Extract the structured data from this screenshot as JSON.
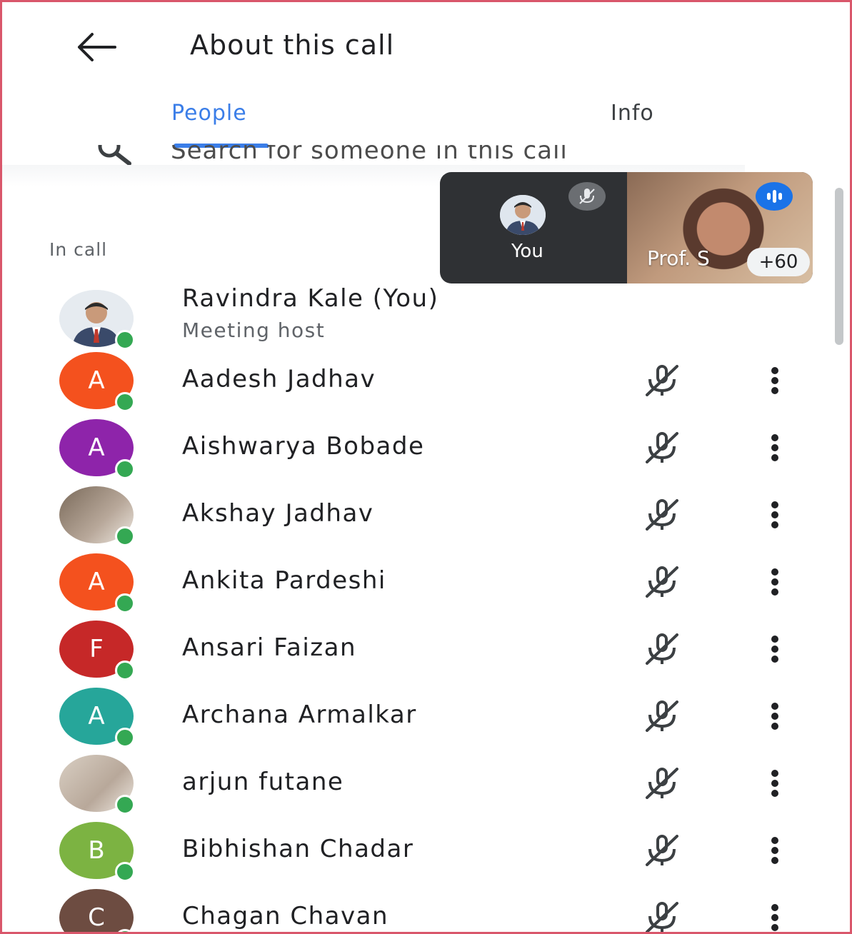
{
  "header": {
    "title": "About this call",
    "back_icon": "arrow-left-icon"
  },
  "tabs": [
    {
      "label": "People",
      "selected": true
    },
    {
      "label": "Info",
      "selected": false
    }
  ],
  "search": {
    "placeholder": "Search for someone in this call",
    "icon": "search-icon"
  },
  "self_view": {
    "label": "You",
    "remote_label": "Prof. S",
    "others_count": "+60"
  },
  "section": {
    "label": "In call"
  },
  "host": {
    "name": "Ravindra Kale (You)",
    "role": "Meeting host"
  },
  "participants": [
    {
      "name": "Aadesh Jadhav",
      "initial": "A",
      "color": "#f4511e"
    },
    {
      "name": "Aishwarya Bobade",
      "initial": "A",
      "color": "#8e24aa"
    },
    {
      "name": "Akshay Jadhav",
      "initial": "",
      "color": "#7a6a5a"
    },
    {
      "name": "Ankita Pardeshi",
      "initial": "A",
      "color": "#f4511e"
    },
    {
      "name": "Ansari Faizan",
      "initial": "F",
      "color": "#c62828"
    },
    {
      "name": "Archana Armalkar",
      "initial": "A",
      "color": "#26a69a"
    },
    {
      "name": "arjun futane",
      "initial": "",
      "color": "#d9cfc3"
    },
    {
      "name": "Bibhishan Chadar",
      "initial": "B",
      "color": "#7cb342"
    },
    {
      "name": "Chagan Chavan",
      "initial": "C",
      "color": "#6d4c41"
    }
  ],
  "colors": {
    "accent": "#3b7ee8",
    "online": "#34a853",
    "frame_border": "#d9576b"
  }
}
